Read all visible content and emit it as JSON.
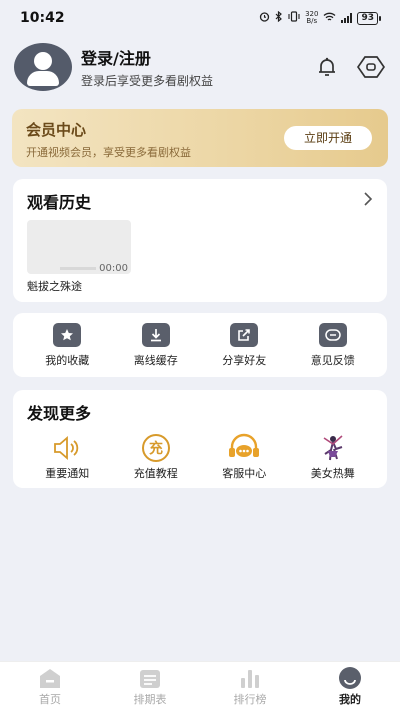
{
  "status_bar": {
    "time": "10:42",
    "net_speed_value": "320",
    "net_speed_unit": "B/s",
    "battery": "93"
  },
  "profile": {
    "title": "登录/注册",
    "subtitle": "登录后享受更多看剧权益",
    "icons": [
      "bell-icon",
      "settings-icon"
    ]
  },
  "vip": {
    "title": "会员中心",
    "subtitle": "开通视频会员，享受更多看剧权益",
    "button": "立即开通",
    "colors": {
      "gradient_start": "#f3e4c1",
      "gradient_end": "#e6ca8d"
    }
  },
  "history": {
    "title": "观看历史",
    "items": [
      {
        "title": "魁拔之殊途",
        "duration": "00:00"
      }
    ]
  },
  "tools": [
    {
      "label": "我的收藏",
      "icon": "star-icon"
    },
    {
      "label": "离线缓存",
      "icon": "download-icon"
    },
    {
      "label": "分享好友",
      "icon": "share-icon"
    },
    {
      "label": "意见反馈",
      "icon": "feedback-icon"
    }
  ],
  "discover": {
    "title": "发现更多",
    "items": [
      {
        "label": "重要通知",
        "icon": "speaker-icon"
      },
      {
        "label": "充值教程",
        "icon": "recharge-icon",
        "icon_text": "充"
      },
      {
        "label": "客服中心",
        "icon": "headset-icon"
      },
      {
        "label": "美女热舞",
        "icon": "dancer-icon"
      }
    ]
  },
  "tabbar": {
    "tabs": [
      {
        "label": "首页",
        "icon": "home-icon"
      },
      {
        "label": "排期表",
        "icon": "calendar-icon"
      },
      {
        "label": "排行榜",
        "icon": "ranking-icon"
      },
      {
        "label": "我的",
        "icon": "profile-icon",
        "active": true
      }
    ]
  }
}
